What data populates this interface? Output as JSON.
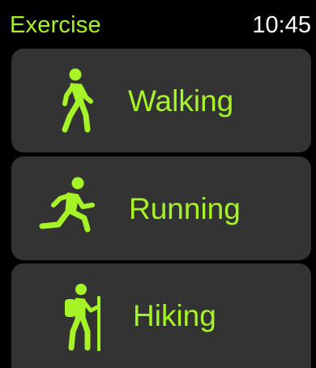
{
  "header": {
    "title": "Exercise",
    "time": "10:45"
  },
  "workouts": [
    {
      "label": "Walking",
      "icon": "walking-figure-icon"
    },
    {
      "label": "Running",
      "icon": "running-figure-icon"
    },
    {
      "label": "Hiking",
      "icon": "hiking-figure-icon"
    }
  ],
  "colors": {
    "accent": "#a6f428",
    "card_background": "#333333",
    "background": "#000000",
    "clock_text": "#ffffff"
  }
}
